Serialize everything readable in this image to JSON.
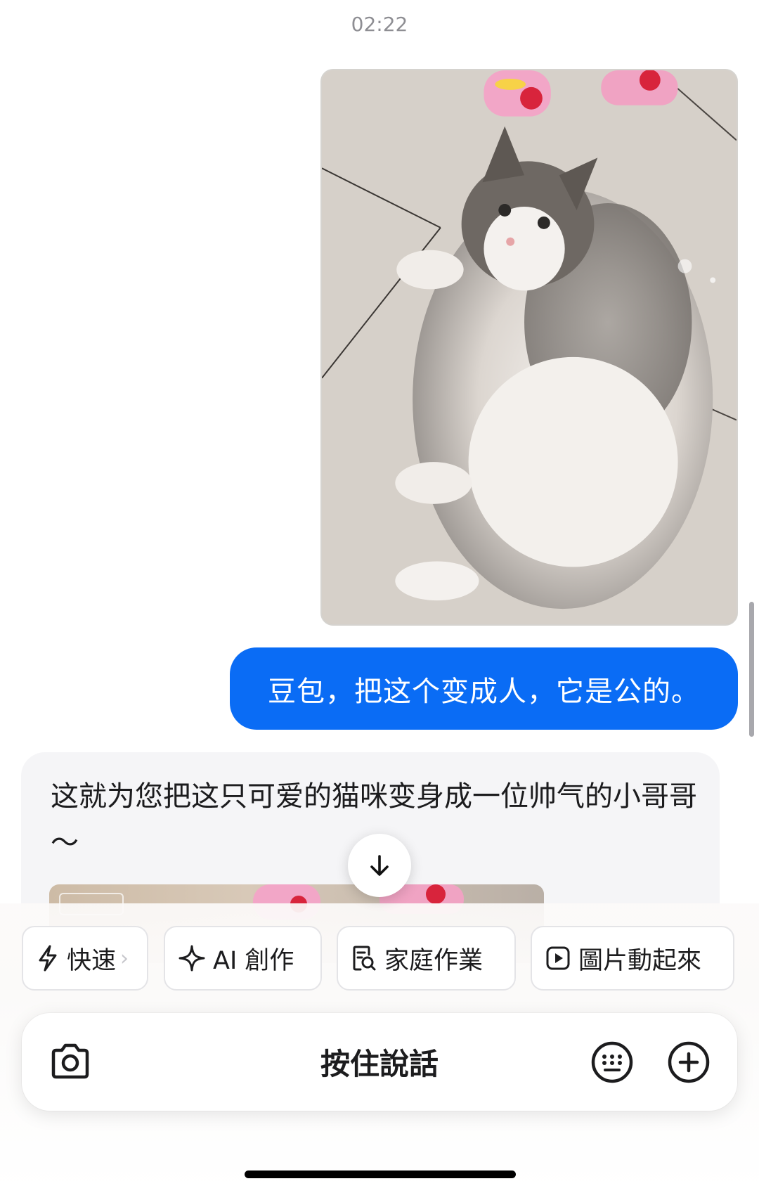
{
  "chat": {
    "timestamp": "02:22",
    "user_message": "豆包，把这个变成人，它是公的。",
    "bot_message": "这就为您把这只可爱的猫咪变身成一位帅气的小哥哥～"
  },
  "toolbar": {
    "chips": [
      {
        "label": "快速",
        "icon": "lightning-icon"
      },
      {
        "label": "AI 創作",
        "icon": "sparkle-icon"
      },
      {
        "label": "家庭作業",
        "icon": "document-search-icon"
      },
      {
        "label": "圖片動起來",
        "icon": "play-icon"
      }
    ],
    "chip_more": "›"
  },
  "input": {
    "label": "按住說話",
    "left_icon": "camera-icon",
    "right_icons": [
      "keyboard-icon",
      "plus-icon"
    ]
  },
  "colors": {
    "user_bubble": "#0a6cf5",
    "bot_card": "#f5f5f7",
    "timestamp": "#8e8e93"
  }
}
